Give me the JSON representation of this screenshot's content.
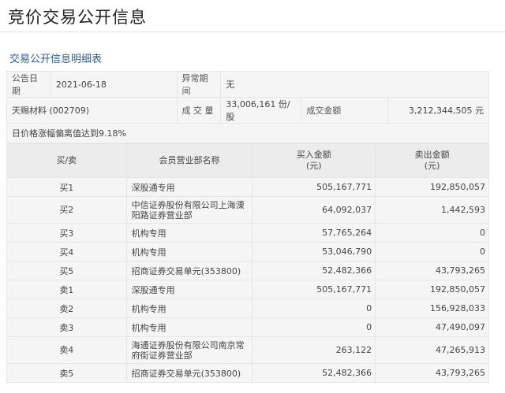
{
  "page_title": "竞价交易公开信息",
  "section_title": "交易公开信息明细表",
  "info": {
    "announce_date_label": "公告日期",
    "announce_date": "2021-06-18",
    "abnormal_period_label": "异常期间",
    "abnormal_period": "无",
    "stock": "天赐材料 (002709)",
    "volume_label": "成 交 量",
    "volume": "33,006,161 份/股",
    "amount_label": "成交金额",
    "amount": "3,212,344,505 元",
    "reason": "日价格涨幅偏离值达到9.18%"
  },
  "table": {
    "headers": {
      "side": "买/卖",
      "dept": "会员营业部名称",
      "buy": "买入金额",
      "buy_unit": "(元)",
      "sell": "卖出金额",
      "sell_unit": "(元)"
    },
    "rows": [
      {
        "side": "买1",
        "dept": "深股通专用",
        "buy": "505,167,771",
        "sell": "192,850,057"
      },
      {
        "side": "买2",
        "dept": "中信证券股份有限公司上海溧阳路证券营业部",
        "buy": "64,092,037",
        "sell": "1,442,593"
      },
      {
        "side": "买3",
        "dept": "机构专用",
        "buy": "57,765,264",
        "sell": "0"
      },
      {
        "side": "买4",
        "dept": "机构专用",
        "buy": "53,046,790",
        "sell": "0"
      },
      {
        "side": "买5",
        "dept": "招商证券交易单元(353800)",
        "buy": "52,482,366",
        "sell": "43,793,265"
      },
      {
        "side": "卖1",
        "dept": "深股通专用",
        "buy": "505,167,771",
        "sell": "192,850,057"
      },
      {
        "side": "卖2",
        "dept": "机构专用",
        "buy": "0",
        "sell": "156,928,033"
      },
      {
        "side": "卖3",
        "dept": "机构专用",
        "buy": "0",
        "sell": "47,490,097"
      },
      {
        "side": "卖4",
        "dept": "海通证券股份有限公司南京常府街证券营业部",
        "buy": "263,122",
        "sell": "47,265,913"
      },
      {
        "side": "卖5",
        "dept": "招商证券交易单元(353800)",
        "buy": "52,482,366",
        "sell": "43,793,265"
      }
    ]
  }
}
